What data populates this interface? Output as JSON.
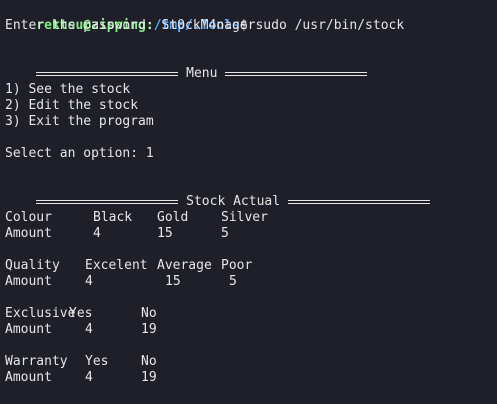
{
  "prompt": {
    "user_host": "rektsu@zipping",
    "sep": ":",
    "path": "/tmp/.Tools",
    "symbol": "$",
    "command": " sudo /usr/bin/stock"
  },
  "password_line": "Enter the password: St0ckM4nager",
  "menu": {
    "title": "Menu",
    "items": [
      "1) See the stock",
      "2) Edit the stock",
      "3) Exit the program"
    ],
    "select_line": "Select an option: 1"
  },
  "stock": {
    "title": "Stock Actual",
    "tables": [
      {
        "header": [
          "Colour",
          "Black",
          "Gold",
          "Silver"
        ],
        "values": [
          "Amount",
          "4",
          "15",
          "5"
        ]
      },
      {
        "header": [
          "Quality",
          "Excelent",
          "Average",
          "Poor"
        ],
        "values": [
          "Amount",
          "4",
          "15",
          "5"
        ]
      },
      {
        "header": [
          "Exclusive",
          "Yes",
          "No"
        ],
        "values": [
          "Amount",
          "4",
          "19"
        ]
      },
      {
        "header": [
          "Warranty",
          "Yes",
          "No"
        ],
        "values": [
          "Amount",
          "4",
          "19"
        ]
      }
    ]
  }
}
